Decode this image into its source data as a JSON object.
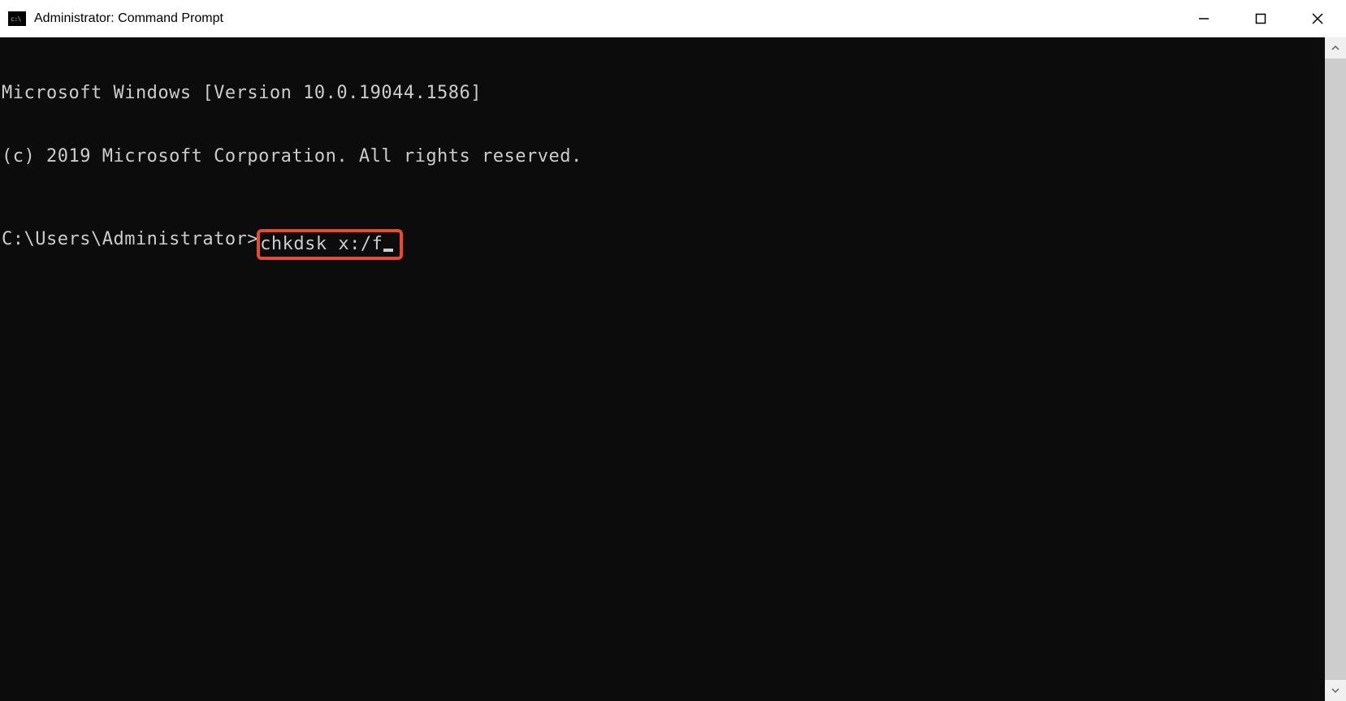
{
  "window": {
    "title": "Administrator: Command Prompt"
  },
  "terminal": {
    "line1": "Microsoft Windows [Version 10.0.19044.1586]",
    "line2": "(c) 2019 Microsoft Corporation. All rights reserved.",
    "prompt": "C:\\Users\\Administrator>",
    "command": "chkdsk x:/f"
  },
  "highlight": {
    "color": "#e84a32"
  }
}
